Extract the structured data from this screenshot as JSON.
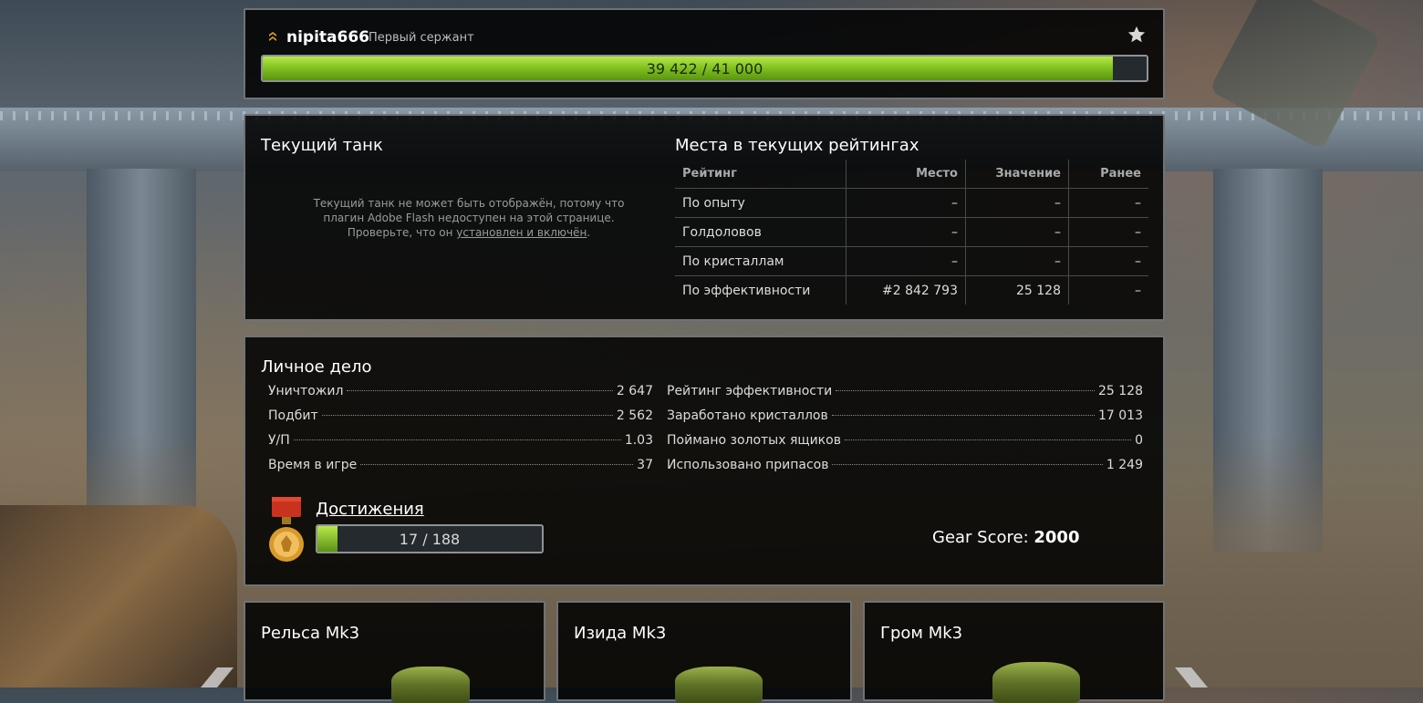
{
  "profile": {
    "username": "nipita666",
    "rank_title": "Первый сержант",
    "xp_text": "39 422 / 41 000",
    "xp_progress": 0.9615
  },
  "current_tank": {
    "heading": "Текущий танк",
    "message_line1": "Текущий танк не может быть отображён, потому что",
    "message_line2": "плагин Adobe Flash недоступен на этой странице.",
    "message_line3_pre": "Проверьте, что он ",
    "message_link": "установлен и включён",
    "message_line3_post": "."
  },
  "ratings": {
    "heading": "Места в текущих рейтингах",
    "columns": [
      "Рейтинг",
      "Место",
      "Значение",
      "Ранее"
    ],
    "rows": [
      [
        "По опыту",
        "–",
        "–",
        "–"
      ],
      [
        "Голдоловов",
        "–",
        "–",
        "–"
      ],
      [
        "По кристаллам",
        "–",
        "–",
        "–"
      ],
      [
        "По эффективности",
        "#2 842 793",
        "25 128",
        "–"
      ]
    ]
  },
  "personal": {
    "heading": "Личное дело",
    "left": [
      {
        "label": "Уничтожил",
        "value": "2 647"
      },
      {
        "label": "Подбит",
        "value": "2 562"
      },
      {
        "label": "У/П",
        "value": "1.03"
      },
      {
        "label": "Время в игре",
        "value": "37"
      }
    ],
    "right": [
      {
        "label": "Рейтинг эффективности",
        "value": "25 128"
      },
      {
        "label": "Заработано кристаллов",
        "value": "17 013"
      },
      {
        "label": "Поймано золотых ящиков",
        "value": "0"
      },
      {
        "label": "Использовано припасов",
        "value": "1 249"
      }
    ],
    "achievements_label": "Достижения",
    "achievements_text": "17 / 188",
    "achievements_progress": 0.0904,
    "gear_label": "Gear Score: ",
    "gear_value": "2000"
  },
  "items": [
    {
      "name": "Рельса Mk3"
    },
    {
      "name": "Изида Mk3"
    },
    {
      "name": "Гром Mk3"
    }
  ],
  "colors": {
    "accent_green": "#7fbf1e",
    "panel_border": "#6f7376"
  }
}
